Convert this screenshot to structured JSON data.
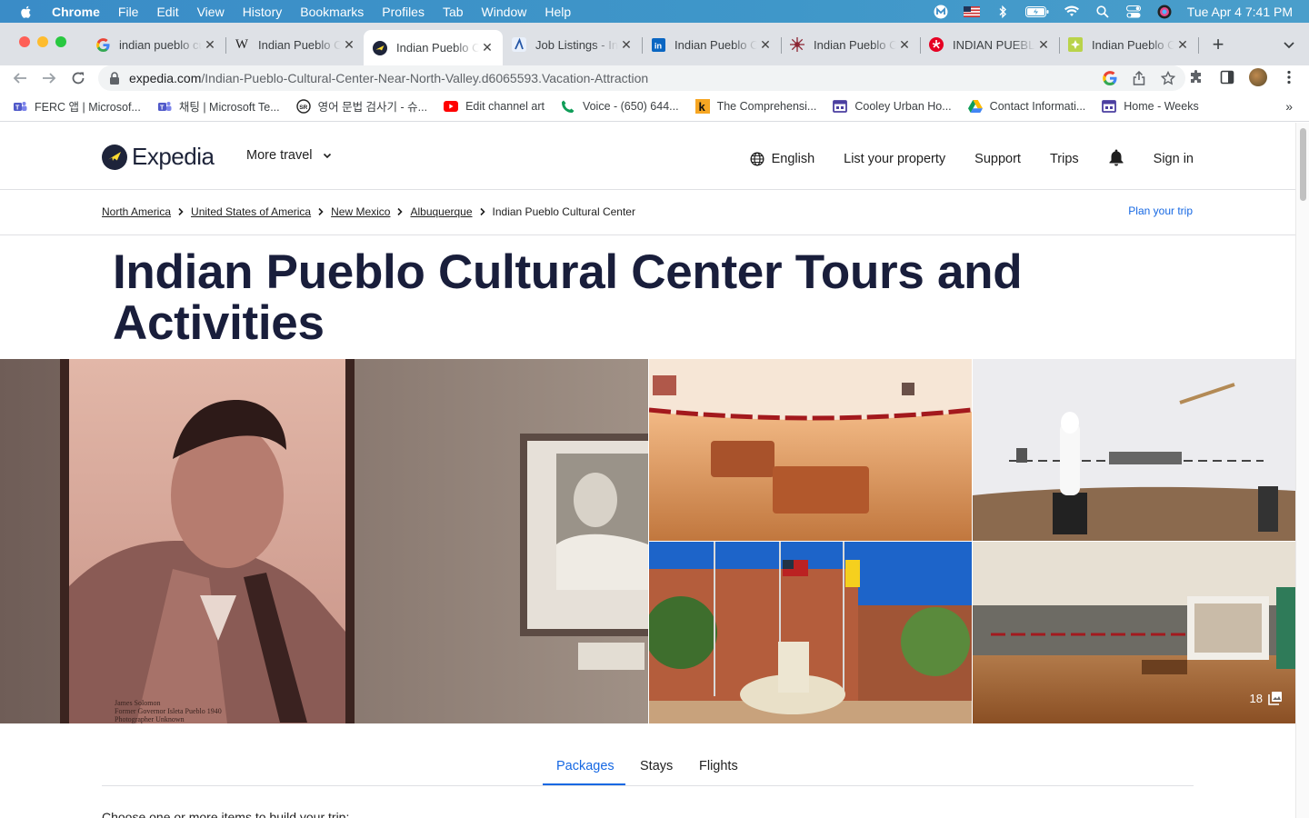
{
  "menubar": {
    "app": "Chrome",
    "items": [
      "File",
      "Edit",
      "View",
      "History",
      "Bookmarks",
      "Profiles",
      "Tab",
      "Window",
      "Help"
    ],
    "clock": "Tue Apr 4  7:41 PM"
  },
  "tabs": [
    {
      "title": "indian pueblo cultural"
    },
    {
      "title": "Indian Pueblo Cultural"
    },
    {
      "title": "Indian Pueblo Cultural"
    },
    {
      "title": "Job Listings - Indeed"
    },
    {
      "title": "Indian Pueblo Cultural"
    },
    {
      "title": "Indian Pueblo Cultural"
    },
    {
      "title": "INDIAN PUEBLO CULTURAL"
    },
    {
      "title": "Indian Pueblo Cultural"
    }
  ],
  "omnibox": {
    "host": "expedia.com",
    "path": "/Indian-Pueblo-Cultural-Center-Near-North-Valley.d6065593.Vacation-Attraction"
  },
  "bookmarks": [
    {
      "label": "FERC 앱 | Microsof..."
    },
    {
      "label": "채팅 | Microsoft Te..."
    },
    {
      "label": "영어 문법 검사기 - 슈..."
    },
    {
      "label": "Edit channel art"
    },
    {
      "label": "Voice - (650) 644..."
    },
    {
      "label": "The Comprehensi..."
    },
    {
      "label": "Cooley Urban Ho..."
    },
    {
      "label": "Contact Informati..."
    },
    {
      "label": "Home - Weeks"
    }
  ],
  "header": {
    "logo": "Expedia",
    "more_travel": "More travel",
    "language": "English",
    "list_property": "List your property",
    "support": "Support",
    "trips": "Trips",
    "sign_in": "Sign in"
  },
  "breadcrumbs": [
    "North America",
    "United States of America",
    "New Mexico",
    "Albuquerque",
    "Indian Pueblo Cultural Center"
  ],
  "plan_trip": "Plan your trip",
  "title": "Indian Pueblo Cultural Center Tours and Activities",
  "gallery": {
    "photo_count": "18",
    "photo1_caption": "James Solomon\nFormer Governor Isleta Pueblo 1940\nPhotographer Unknown"
  },
  "page_tabs": [
    "Packages",
    "Stays",
    "Flights"
  ],
  "active_tab": "Packages",
  "choose_text": "Choose one or more items to build your trip:",
  "colors": {
    "menubar": "#3f97c9",
    "accent": "#1668e3",
    "title": "#191e3b"
  }
}
